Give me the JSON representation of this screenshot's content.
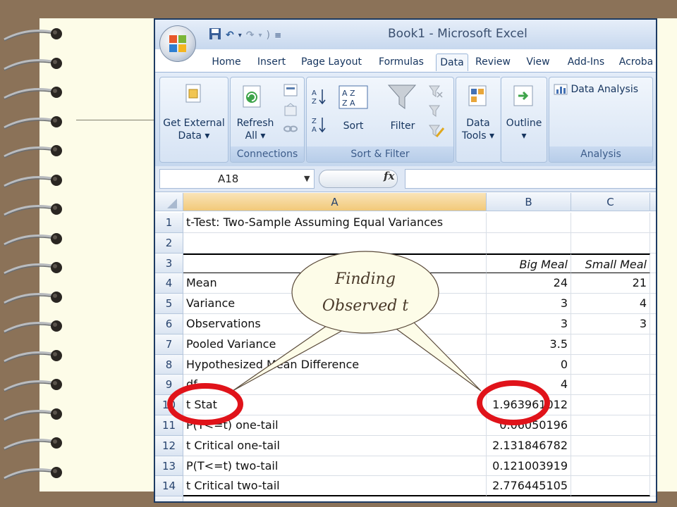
{
  "window": {
    "title": "Book1 - Microsoft Excel"
  },
  "tabs": [
    "Home",
    "Insert",
    "Page Layout",
    "Formulas",
    "Data",
    "Review",
    "View",
    "Add-Ins",
    "Acroba"
  ],
  "active_tab": "Data",
  "ribbon": {
    "get_external_data": {
      "line1": "Get External",
      "line2": "Data ▾"
    },
    "refresh_all": {
      "line1": "Refresh",
      "line2": "All ▾"
    },
    "connections_label": "Connections",
    "sort": "Sort",
    "filter": "Filter",
    "sort_filter_label": "Sort & Filter",
    "data_tools": {
      "line1": "Data",
      "line2": "Tools ▾"
    },
    "outline": {
      "line1": "Outline",
      "line2": "▾"
    },
    "data_analysis": "Data Analysis",
    "analysis_label": "Analysis"
  },
  "formula_bar": {
    "name_box": "A18",
    "fx": "fx",
    "value": ""
  },
  "columns": [
    "A",
    "B",
    "C"
  ],
  "rows": [
    {
      "n": "1",
      "a": "t-Test: Two-Sample Assuming Equal Variances",
      "b": "",
      "c": ""
    },
    {
      "n": "2",
      "a": "",
      "b": "",
      "c": ""
    },
    {
      "n": "3",
      "a": "",
      "b": "Big Meal",
      "c": "Small Meal"
    },
    {
      "n": "4",
      "a": "Mean",
      "b": "24",
      "c": "21"
    },
    {
      "n": "5",
      "a": "Variance",
      "b": "3",
      "c": "4"
    },
    {
      "n": "6",
      "a": "Observations",
      "b": "3",
      "c": "3"
    },
    {
      "n": "7",
      "a": "Pooled Variance",
      "b": "3.5",
      "c": ""
    },
    {
      "n": "8",
      "a": "Hypothesized Mean Difference",
      "b": "0",
      "c": ""
    },
    {
      "n": "9",
      "a": "df",
      "b": "4",
      "c": ""
    },
    {
      "n": "10",
      "a": "t Stat",
      "b": "1.963961012",
      "c": ""
    },
    {
      "n": "11",
      "a": "P(T<=t) one-tail",
      "b": "0.06050196",
      "c": ""
    },
    {
      "n": "12",
      "a": "t Critical one-tail",
      "b": "2.131846782",
      "c": ""
    },
    {
      "n": "13",
      "a": "P(T<=t) two-tail",
      "b": "0.121003919",
      "c": ""
    },
    {
      "n": "14",
      "a": "t Critical two-tail",
      "b": "2.776445105",
      "c": ""
    }
  ],
  "callout": {
    "line1": "Finding",
    "line2": "Observed t"
  },
  "colors": {
    "background": "#8b7258",
    "paper": "#fdfce8",
    "highlight_ring": "#e0131a",
    "callout_fill": "#fdfce8"
  }
}
